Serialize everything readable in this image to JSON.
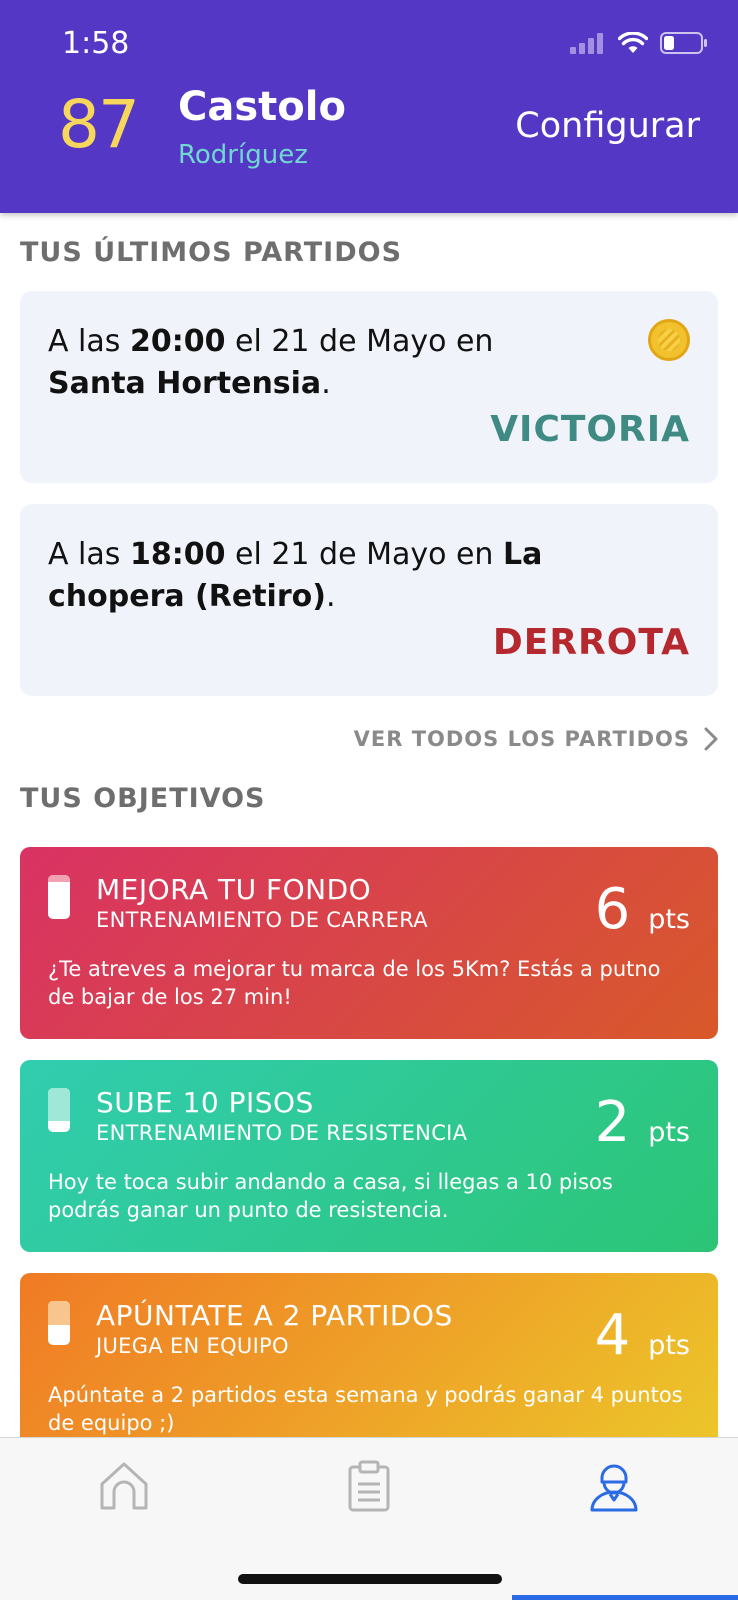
{
  "status_bar": {
    "time": "1:58"
  },
  "header": {
    "score": "87",
    "first_name": "Castolo",
    "last_name": "Rodríguez",
    "configure_label": "Configurar"
  },
  "matches_section": {
    "title": "TUS ÚLTIMOS PARTIDOS",
    "matches": [
      {
        "prefix": "A las ",
        "time": "20:00",
        "middle": " el 21 de Mayo en ",
        "place": "Santa Hortensia",
        "suffix": ".",
        "result": "VICTORIA",
        "result_color": "#3f8a82"
      },
      {
        "prefix": "A las ",
        "time": "18:00",
        "middle": " el 21 de Mayo en ",
        "place": "La chopera (Retiro)",
        "suffix": ".",
        "result": "DERROTA",
        "result_color": "#b5282e"
      }
    ],
    "see_all_label": "VER TODOS LOS PARTIDOS"
  },
  "goals_section": {
    "title": "TUS OBJETIVOS",
    "goals": [
      {
        "title": "MEJORA TU FONDO",
        "subtitle": "ENTRENAMIENTO DE CARRERA",
        "points": "6",
        "points_unit": "pts",
        "description": "¿Te atreves a mejorar tu marca de los 5Km? Estás a putno de bajar de los 27 min!",
        "gradient": [
          "#d93264",
          "#d8592a"
        ],
        "progress": 0.15
      },
      {
        "title": "SUBE 10 PISOS",
        "subtitle": "ENTRENAMIENTO DE RESISTENCIA",
        "points": "2",
        "points_unit": "pts",
        "description": "Hoy te toca subir andando a casa, si llegas a 10 pisos podrás ganar un punto de resistencia.",
        "gradient": [
          "#31cdb0",
          "#2cc576"
        ],
        "progress": 0.75
      },
      {
        "title": "APÚNTATE A 2 PARTIDOS",
        "subtitle": "JUEGA EN EQUIPO",
        "points": "4",
        "points_unit": "pts",
        "description": "Apúntate a 2 partidos esta semana y podrás ganar 4 puntos de equipo ;)",
        "gradient": [
          "#f07a25",
          "#ecc82a"
        ],
        "progress": 0.55
      }
    ]
  },
  "tabbar": {
    "tabs": [
      {
        "icon": "home-icon",
        "active": false
      },
      {
        "icon": "clipboard-icon",
        "active": false
      },
      {
        "icon": "profile-icon",
        "active": true
      }
    ],
    "active_color": "#2b6be5",
    "inactive_color": "#b5b5b5"
  }
}
